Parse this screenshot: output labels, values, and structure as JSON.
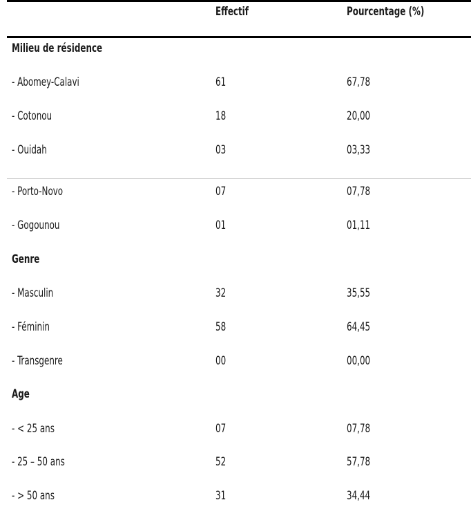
{
  "table": {
    "headers": {
      "label": "",
      "effectif": "Effectif",
      "pourcentage": "Pourcentage (%)"
    },
    "sections": [
      {
        "title": "Milieu de résidence",
        "rows": [
          {
            "label": "- Abomey-Calavi",
            "effectif": "61",
            "pourcentage": "67,78"
          },
          {
            "label": "- Cotonou",
            "effectif": "18",
            "pourcentage": "20,00"
          },
          {
            "label": "- Ouidah",
            "effectif": "03",
            "pourcentage": "03,33"
          },
          {
            "label": "- Porto-Novo",
            "effectif": "07",
            "pourcentage": "07,78"
          },
          {
            "label": "- Gogounou",
            "effectif": "01",
            "pourcentage": "01,11"
          }
        ]
      },
      {
        "title": "Genre",
        "rows": [
          {
            "label": "- Masculin",
            "effectif": "32",
            "pourcentage": "35,55"
          },
          {
            "label": "- Féminin",
            "effectif": "58",
            "pourcentage": "64,45"
          },
          {
            "label": "- Transgenre",
            "effectif": "00",
            "pourcentage": "00,00"
          }
        ]
      },
      {
        "title": "Age",
        "rows": [
          {
            "label": "- < 25 ans",
            "effectif": "07",
            "pourcentage": "07,78"
          },
          {
            "label": "- 25 – 50 ans",
            "effectif": "52",
            "pourcentage": "57,78"
          },
          {
            "label": "- > 50 ans",
            "effectif": "31",
            "pourcentage": "34,44"
          }
        ]
      }
    ]
  }
}
